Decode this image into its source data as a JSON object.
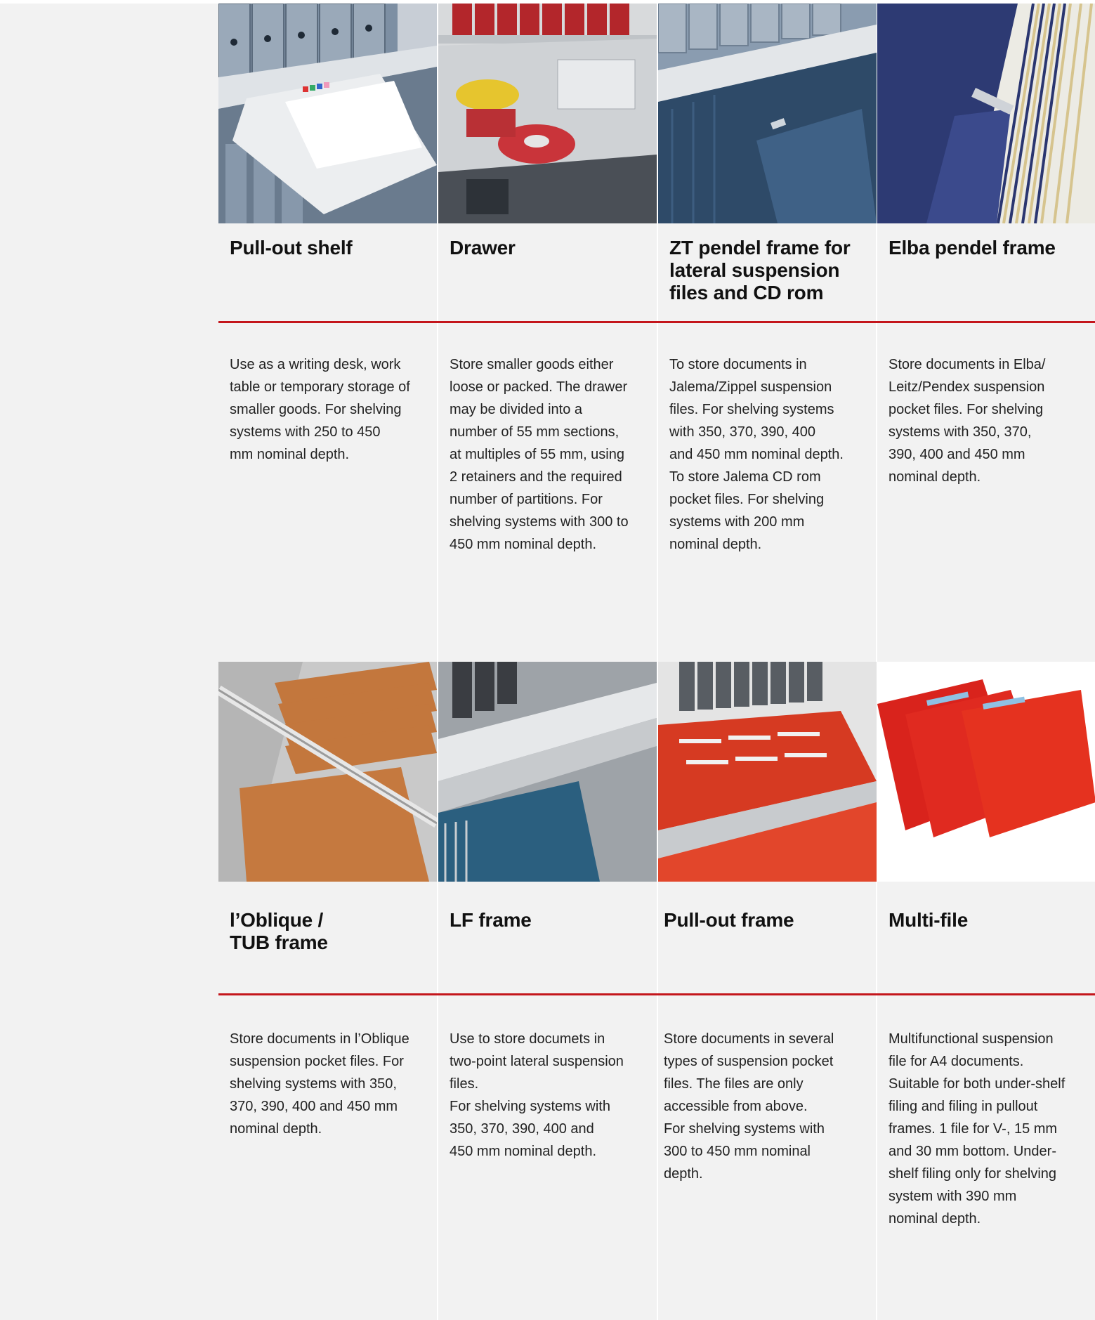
{
  "row1": [
    {
      "title": "Pull-out shelf",
      "photo": "pull-out-shelf-photo",
      "description": "Use as a writing desk, work\ntable or temporary storage of\nsmaller goods. For shelving\nsystems with 250 to 450\nmm nominal depth."
    },
    {
      "title": "Drawer",
      "photo": "drawer-photo",
      "description": "Store smaller goods either\nloose or packed. The drawer\nmay be divided into a\nnumber of 55 mm sections,\nat multiples of 55 mm, using\n2 retainers and the required\nnumber of partitions. For\nshelving systems with 300 to\n450 mm nominal depth."
    },
    {
      "title": "ZT pendel frame for\nlateral suspension\nfiles and CD rom",
      "photo": "zt-pendel-frame-photo",
      "description": "To store documents in\nJalema/Zippel suspension\nfiles. For shelving systems\nwith 350, 370, 390, 400\nand 450 mm nominal depth.\nTo store Jalema CD rom\npocket files. For shelving\nsystems with 200 mm\nnominal depth."
    },
    {
      "title": "Elba pendel frame",
      "photo": "elba-pendel-frame-photo",
      "description": "Store documents in Elba/\nLeitz/Pendex suspension\npocket files. For shelving\nsystems with 350, 370,\n390, 400 and 450 mm\nnominal depth."
    }
  ],
  "row2": [
    {
      "title": "l’Oblique /\nTUB frame",
      "photo": "loblique-tub-frame-photo",
      "description": "Store documents in l’Oblique\nsuspension pocket files. For\nshelving systems with 350,\n370, 390, 400 and 450 mm\nnominal depth."
    },
    {
      "title": "LF frame",
      "photo": "lf-frame-photo",
      "description": "Use to store documets in\ntwo-point lateral suspension\nfiles.\nFor shelving systems with\n350, 370, 390, 400 and\n450 mm nominal depth."
    },
    {
      "title": "Pull-out frame",
      "photo": "pull-out-frame-photo",
      "description": "Store documents in several\ntypes of suspension pocket\nfiles. The files are only\naccessible from above.\nFor shelving systems with\n300 to 450 mm nominal\ndepth."
    },
    {
      "title": "Multi-file",
      "photo": "multi-file-photo",
      "description": "Multifunctional suspension\nfile for A4 documents.\nSuitable for both under-shelf\nfiling and filing in pullout\nframes. 1 file for V-, 15 mm\nand 30 mm bottom. Under-\nshelf filing only for shelving\nsystem with 390 mm\nnominal depth."
    }
  ],
  "colors": {
    "accent": "#c4161c",
    "background": "#f2f2f2"
  }
}
